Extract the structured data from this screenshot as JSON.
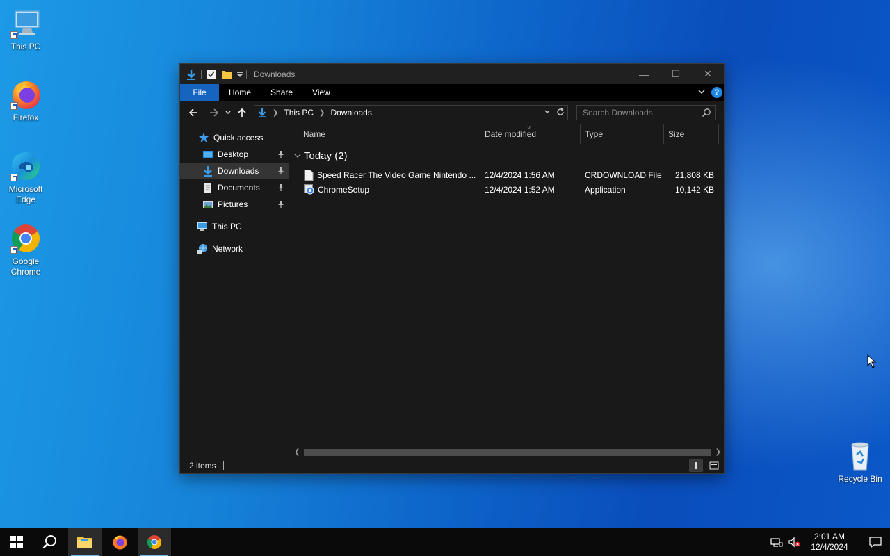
{
  "desktop": {
    "icons": [
      {
        "label": "This PC"
      },
      {
        "label": "Firefox"
      },
      {
        "label": "Microsoft Edge"
      },
      {
        "label": "Google Chrome"
      },
      {
        "label": "Recycle Bin"
      }
    ]
  },
  "window": {
    "title": "Downloads",
    "controls": {
      "minimize": "—",
      "maximize": "☐",
      "close": "✕"
    },
    "ribbon": {
      "tabs": [
        "File",
        "Home",
        "Share",
        "View"
      ],
      "help": "?"
    },
    "address": {
      "crumbs": [
        "This PC",
        "Downloads"
      ]
    },
    "search": {
      "placeholder": "Search Downloads"
    },
    "sidebar": {
      "items": [
        {
          "label": "Quick access"
        },
        {
          "label": "Desktop"
        },
        {
          "label": "Downloads"
        },
        {
          "label": "Documents"
        },
        {
          "label": "Pictures"
        },
        {
          "label": "This PC"
        },
        {
          "label": "Network"
        }
      ]
    },
    "columns": [
      "Name",
      "Date modified",
      "Type",
      "Size"
    ],
    "group": {
      "label": "Today (2)"
    },
    "files": [
      {
        "name": "Speed Racer The Video Game Nintendo ...",
        "date": "12/4/2024 1:56 AM",
        "type": "CRDOWNLOAD File",
        "size": "21,808 KB"
      },
      {
        "name": "ChromeSetup",
        "date": "12/4/2024 1:52 AM",
        "type": "Application",
        "size": "10,142 KB"
      }
    ],
    "status": {
      "items": "2 items"
    }
  },
  "taskbar": {
    "clock": {
      "time": "2:01 AM",
      "date": "12/4/2024"
    }
  },
  "colors": {
    "accent": "#1565c0",
    "window_bg": "#191919",
    "selected_bg": "#353535",
    "taskbar_bg": "#0a0a0a"
  }
}
